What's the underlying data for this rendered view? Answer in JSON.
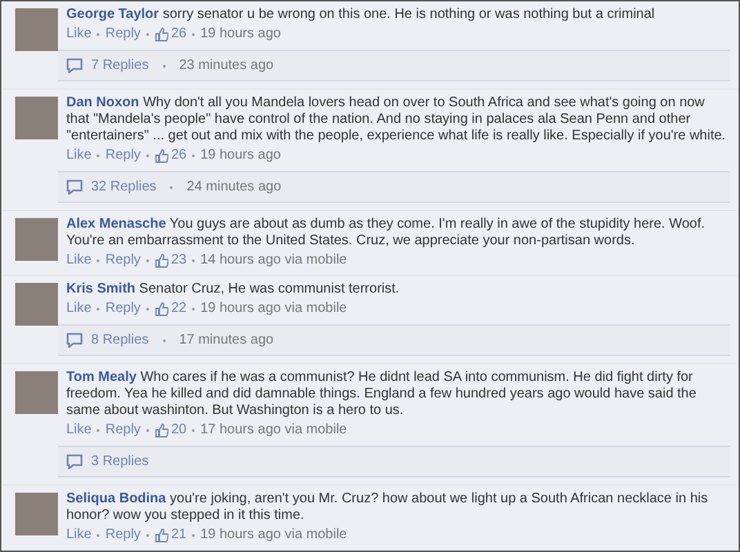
{
  "comments": [
    {
      "author": "George Taylor",
      "text": "sorry senator u be wrong on this one. He is nothing or was nothing but a criminal",
      "actions": [
        "Like",
        "Reply"
      ],
      "likes": "26",
      "time": "19 hours ago",
      "replies": {
        "label": "7 Replies",
        "time": "23 minutes ago"
      }
    },
    {
      "author": "Dan Noxon",
      "text": "Why don't all you Mandela lovers head on over to South Africa and see what's going on now that \"Mandela's people\" have control of the nation. And no staying in palaces ala Sean Penn and other \"entertainers\" ... get out and mix with the people, experience what life is really like. Especially if you're white.",
      "actions": [
        "Like",
        "Reply"
      ],
      "likes": "26",
      "time": "19 hours ago",
      "replies": {
        "label": "32 Replies",
        "time": "24 minutes ago"
      }
    },
    {
      "author": "Alex Menasche",
      "text": "You guys are about as dumb as they come. I'm really in awe of the stupidity here. Woof. You're an embarrassment to the United States. Cruz, we appreciate your non-partisan words.",
      "actions": [
        "Like",
        "Reply"
      ],
      "likes": "23",
      "time": "14 hours ago via mobile"
    },
    {
      "author": "Kris Smith",
      "text": "Senator Cruz, He was communist terrorist.",
      "actions": [
        "Like",
        "Reply"
      ],
      "likes": "22",
      "time": "19 hours ago via mobile",
      "replies": {
        "label": "8 Replies",
        "time": "17 minutes ago"
      }
    },
    {
      "author": "Tom Mealy",
      "text": "Who cares if he was a communist? He didnt lead SA into communism. He did fight dirty for freedom. Yea he killed and did damnable things. England a few hundred years ago would have said the same about washinton. But Washington is a hero to us.",
      "actions": [
        "Like",
        "Reply"
      ],
      "likes": "20",
      "time": "17 hours ago via mobile",
      "replies": {
        "label": "3 Replies"
      }
    },
    {
      "author": "Seliqua Bodina",
      "text": "you're joking, aren't you Mr. Cruz? how about we light up a South African necklace in his honor? wow you stepped in it this time.",
      "actions": [
        "Like",
        "Reply"
      ],
      "likes": "21",
      "time": "19 hours ago via mobile"
    }
  ]
}
